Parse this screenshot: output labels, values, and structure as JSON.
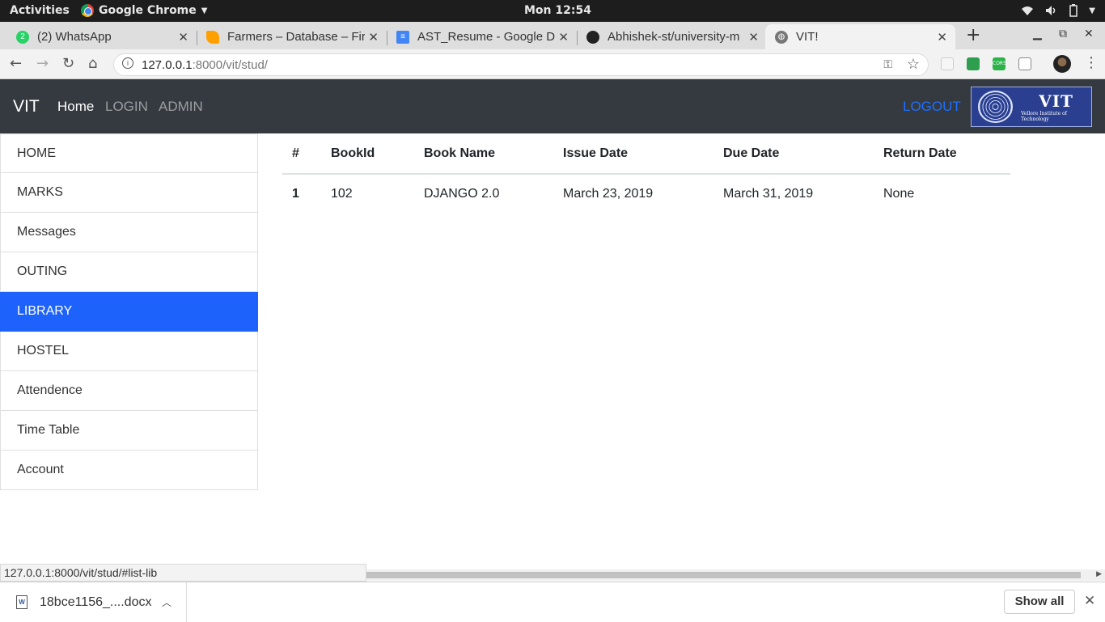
{
  "os": {
    "activities": "Activities",
    "app_name": "Google Chrome",
    "clock": "Mon 12:54"
  },
  "tabs": [
    {
      "title": "(2) WhatsApp",
      "icon": "whatsapp-icon"
    },
    {
      "title": "Farmers – Database – Fire",
      "icon": "firebase-icon"
    },
    {
      "title": "AST_Resume - Google Do",
      "icon": "google-docs-icon"
    },
    {
      "title": "Abhishek-st/university-m",
      "icon": "github-icon"
    },
    {
      "title": "VIT!",
      "icon": "globe-icon"
    }
  ],
  "address": {
    "host": "127.0.0.1",
    "path": ":8000/vit/stud/"
  },
  "nav": {
    "brand": "VIT",
    "links": [
      "Home",
      "LOGIN",
      "ADMIN"
    ],
    "logout": "LOGOUT",
    "logo_text": "VIT",
    "logo_subtext": "Vellore Institute of Technology"
  },
  "sidebar": {
    "items": [
      "HOME",
      "MARKS",
      "Messages",
      "OUTING",
      "LIBRARY",
      "HOSTEL",
      "Attendence",
      "Time Table",
      "Account"
    ],
    "active_index": 4
  },
  "library_table": {
    "headers": [
      "#",
      "BookId",
      "Book Name",
      "Issue Date",
      "Due Date",
      "Return Date"
    ],
    "rows": [
      [
        "1",
        "102",
        "DJANGO 2.0",
        "March 23, 2019",
        "March 31, 2019",
        "None"
      ]
    ]
  },
  "status_url": "127.0.0.1:8000/vit/stud/#list-lib",
  "downloads": {
    "file_name": "18bce1156_....docx",
    "show_all": "Show all"
  },
  "colors": {
    "navbar_bg": "#343a40",
    "active_item": "#1d63fb",
    "logout_link": "#1e6fff"
  }
}
